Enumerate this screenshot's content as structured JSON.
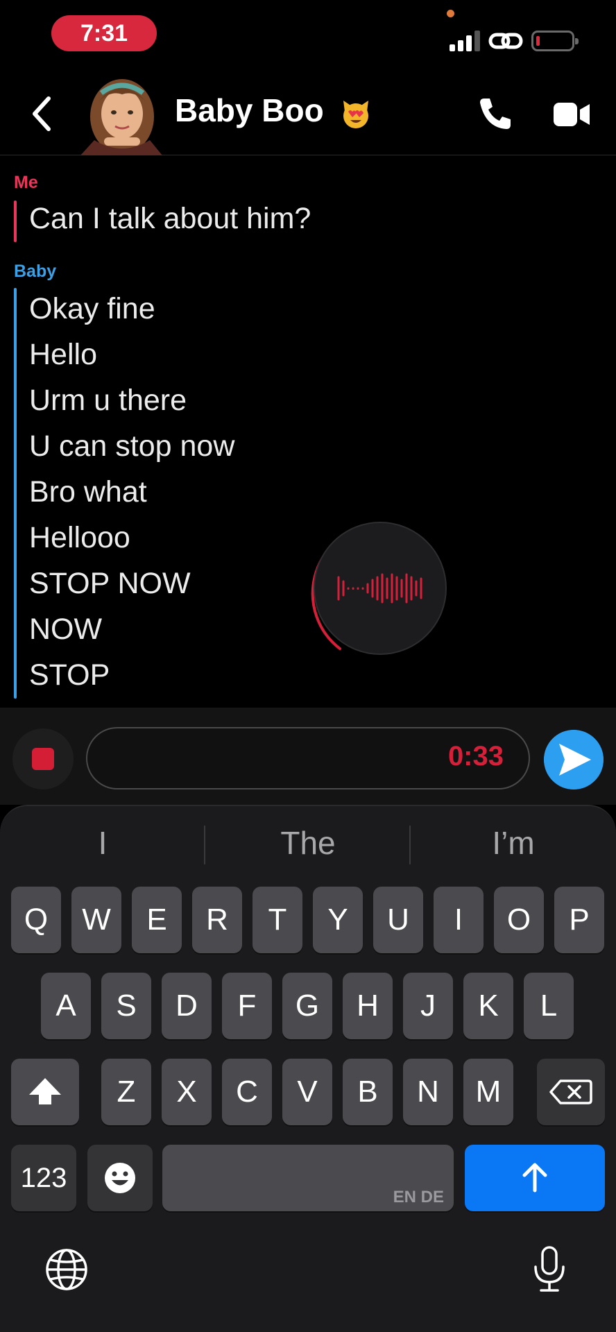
{
  "status_bar": {
    "time": "7:31"
  },
  "header": {
    "contact_name": "Baby Boo"
  },
  "conversation": {
    "me_label": "Me",
    "me_messages": [
      "Can I talk about him?"
    ],
    "baby_label": "Baby",
    "baby_messages": [
      "Okay fine",
      "Hello",
      "Urm u there",
      "U can stop now",
      "Bro what",
      "Hellooo",
      "STOP NOW",
      "NOW",
      "STOP"
    ]
  },
  "recording": {
    "timer": "0:33"
  },
  "keyboard": {
    "predictions": [
      "I",
      "The",
      "I’m"
    ],
    "row1": [
      "Q",
      "W",
      "E",
      "R",
      "T",
      "Y",
      "U",
      "I",
      "O",
      "P"
    ],
    "row2": [
      "A",
      "S",
      "D",
      "F",
      "G",
      "H",
      "J",
      "K",
      "L"
    ],
    "row3": [
      "Z",
      "X",
      "C",
      "V",
      "B",
      "N",
      "M"
    ],
    "numbers_label": "123",
    "space_languages": "EN DE"
  },
  "colors": {
    "me": "#e9365a",
    "baby": "#3aa0e8",
    "record_red": "#d6203a",
    "send_blue": "#2d9ff0",
    "return_blue": "#0a77f5"
  },
  "icons": [
    "back-chevron-icon",
    "bitmoji-avatar",
    "heart-eyes-cat-emoji",
    "phone-icon",
    "video-camera-icon",
    "waveform-icon",
    "stop-icon",
    "send-arrow-icon",
    "shift-icon",
    "backspace-icon",
    "emoji-icon",
    "return-arrow-icon",
    "globe-icon",
    "microphone-icon"
  ]
}
